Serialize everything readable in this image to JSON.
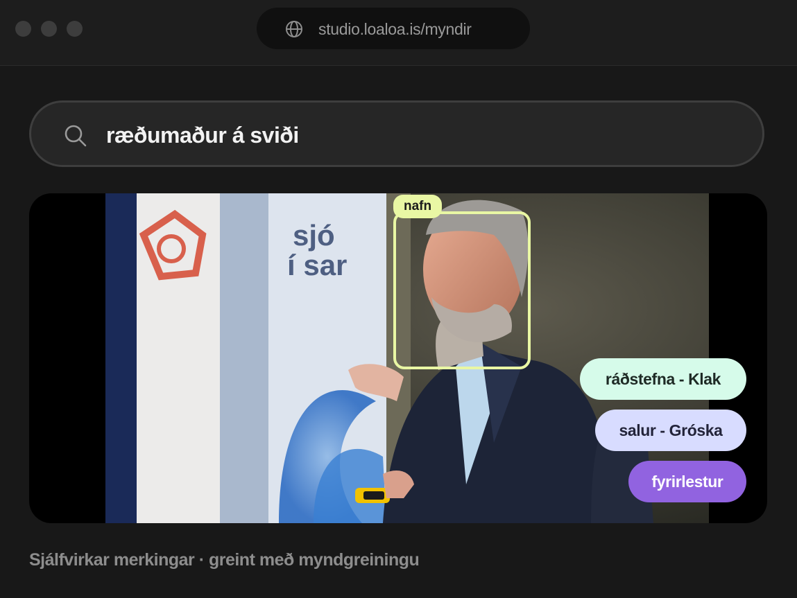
{
  "browser": {
    "url": "studio.loaloa.is/myndir",
    "url_icon": "globe-icon",
    "window_controls": [
      "close",
      "minimize",
      "maximize"
    ]
  },
  "search": {
    "icon": "search-icon",
    "query": "ræðumaður á sviði"
  },
  "photo": {
    "subject": "speaker-on-stage",
    "face_label": "nafn",
    "face_box_color": "#e9f7a4",
    "banner_text": [
      "sjó",
      "í sar"
    ],
    "tags": [
      {
        "label": "ráðstefna - Klak",
        "color": "#d6fbea"
      },
      {
        "label": "salur - Gróska",
        "color": "#d8dcff"
      },
      {
        "label": "fyrirlestur",
        "color": "#9163e0"
      }
    ]
  },
  "caption": "Sjálfvirkar merkingar · greint með myndgreiningu"
}
